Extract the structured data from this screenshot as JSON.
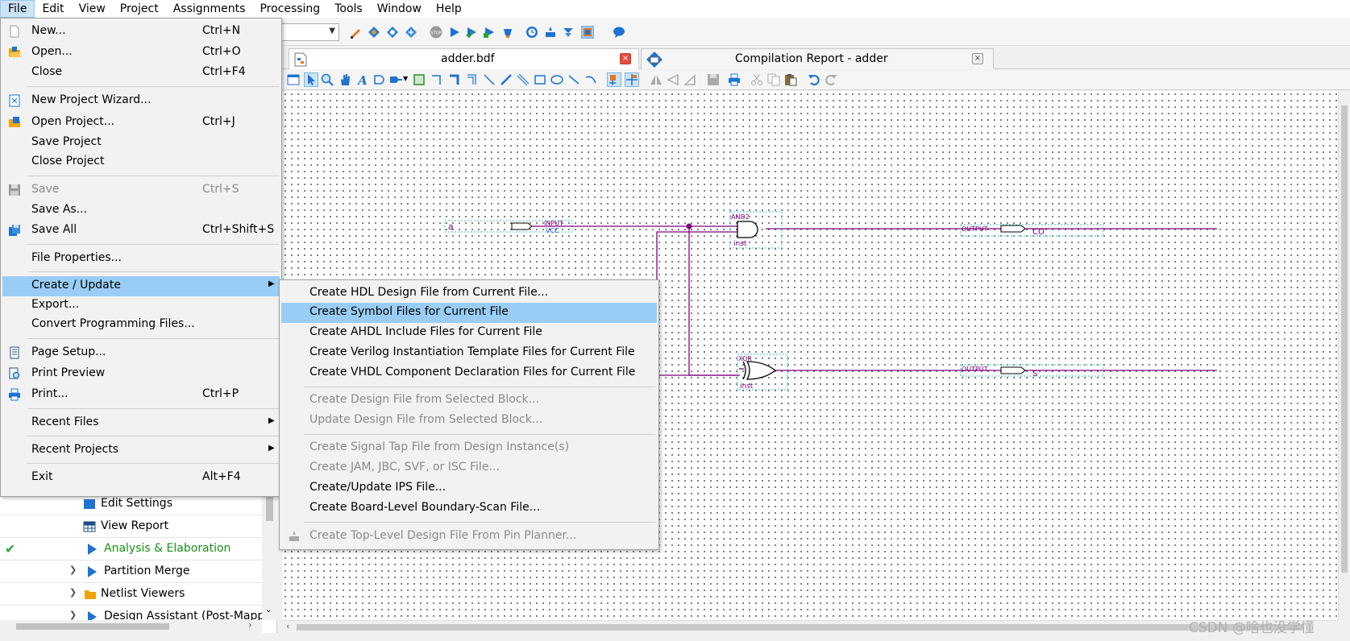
{
  "menubar": [
    "File",
    "Edit",
    "View",
    "Project",
    "Assignments",
    "Processing",
    "Tools",
    "Window",
    "Help"
  ],
  "tabs": {
    "design": {
      "label": "adder.bdf",
      "close": "×"
    },
    "report": {
      "label": "Compilation Report - adder",
      "close": "×"
    }
  },
  "schematic": {
    "input_name": "a",
    "input_type": "INPUT",
    "input_default": "VCC",
    "and_type": "AND2",
    "and_inst": "inst",
    "xor_type": "XOR",
    "xor_inst": "inst",
    "output_type_1": "OUTPUT",
    "output_name_1": "CO",
    "output_type_2": "OUTPUT",
    "output_name_2": "S"
  },
  "file_menu": {
    "new": {
      "label": "New...",
      "shortcut": "Ctrl+N"
    },
    "open": {
      "label": "Open...",
      "shortcut": "Ctrl+O"
    },
    "close": {
      "label": "Close",
      "shortcut": "Ctrl+F4"
    },
    "new_project_wizard": {
      "label": "New Project Wizard..."
    },
    "open_project": {
      "label": "Open Project...",
      "shortcut": "Ctrl+J"
    },
    "save_project": {
      "label": "Save Project"
    },
    "close_project": {
      "label": "Close Project"
    },
    "save": {
      "label": "Save",
      "shortcut": "Ctrl+S"
    },
    "save_as": {
      "label": "Save As..."
    },
    "save_all": {
      "label": "Save All",
      "shortcut": "Ctrl+Shift+S"
    },
    "file_properties": {
      "label": "File Properties..."
    },
    "create_update": {
      "label": "Create / Update"
    },
    "export": {
      "label": "Export..."
    },
    "convert_programming": {
      "label": "Convert Programming Files..."
    },
    "page_setup": {
      "label": "Page Setup..."
    },
    "print_preview": {
      "label": "Print Preview"
    },
    "print": {
      "label": "Print...",
      "shortcut": "Ctrl+P"
    },
    "recent_files": {
      "label": "Recent Files"
    },
    "recent_projects": {
      "label": "Recent Projects"
    },
    "exit": {
      "label": "Exit",
      "shortcut": "Alt+F4"
    }
  },
  "submenu": [
    "Create HDL Design File from Current File...",
    "Create Symbol Files for Current File",
    "Create AHDL Include Files for Current File",
    "Create Verilog Instantiation Template Files for Current File",
    "Create VHDL Component Declaration Files for Current File",
    "Create Design File from Selected Block...",
    "Update Design File from Selected Block...",
    "Create Signal Tap File from Design Instance(s)",
    "Create JAM, JBC, SVF, or ISC File...",
    "Create/Update IPS File...",
    "Create Board-Level Boundary-Scan File...",
    "Create Top-Level Design File From Pin Planner..."
  ],
  "tasks": {
    "edit_settings": "Edit Settings",
    "view_report": "View Report",
    "analysis_elaboration": "Analysis & Elaboration",
    "partition_merge": "Partition Merge",
    "netlist_viewers": "Netlist Viewers",
    "design_assistant": "Design Assistant (Post-Mapp"
  },
  "colors": {
    "wire": "#800080",
    "menu_highlight": "#99cdf5",
    "success_check": "#2aa52a",
    "task_play": "#1e73d2"
  },
  "watermark": "CSDN @啥也没学懂"
}
